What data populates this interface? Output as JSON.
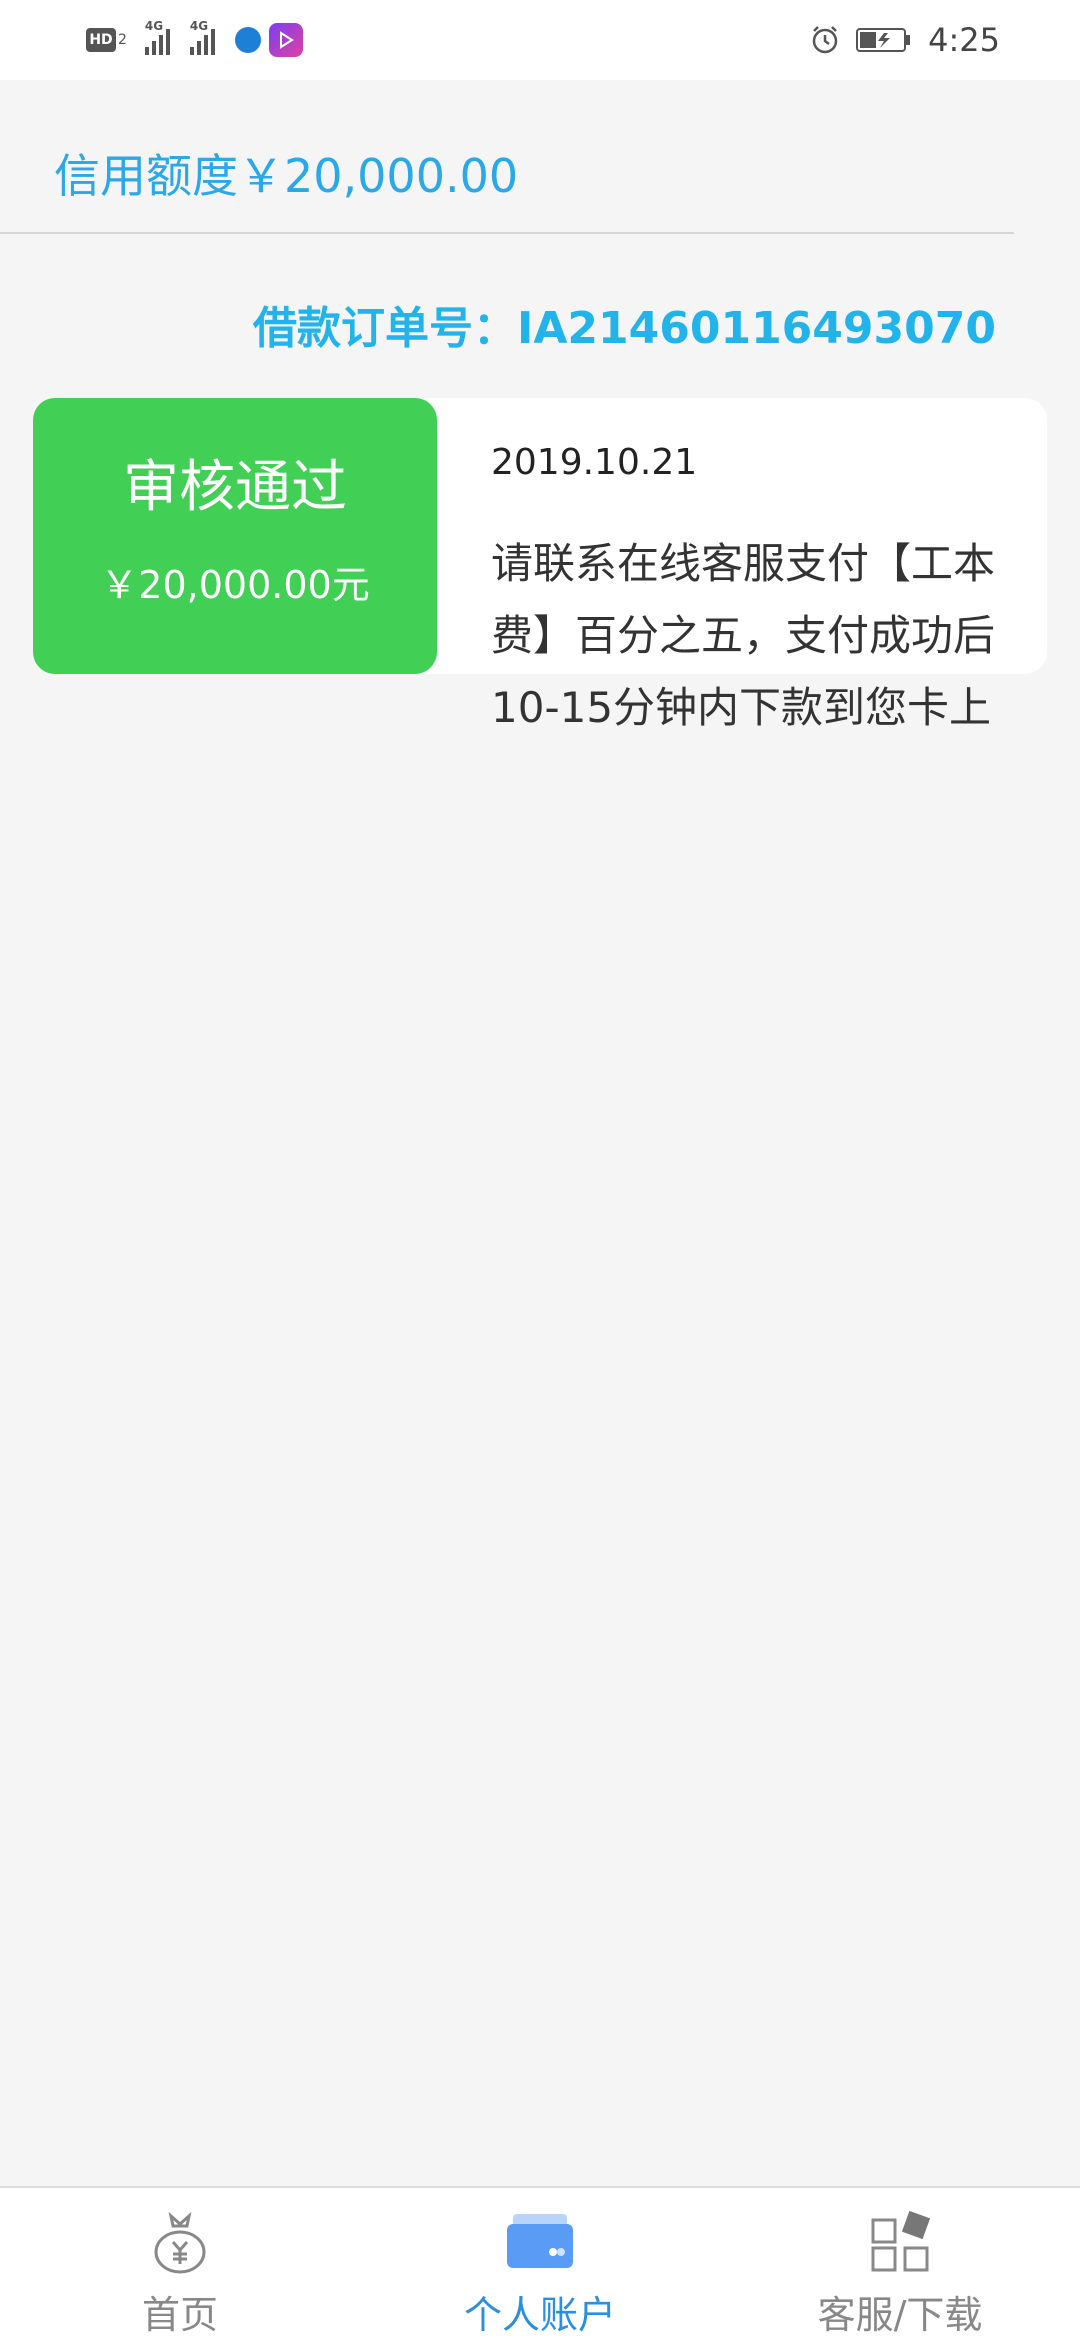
{
  "status_bar": {
    "hd": "HD",
    "hd_sub": "2",
    "net1": "4G",
    "net2": "4G",
    "time": "4:25"
  },
  "header": {
    "credit_text": "信用额度￥20,000.00",
    "order_text": "借款订单号：IA21460116493070"
  },
  "card": {
    "status": "审核通过",
    "amount": "￥20,000.00元",
    "date": "2019.10.21",
    "message": "请联系在线客服支付【工本费】百分之五，支付成功后10-15分钟内下款到您卡上"
  },
  "bottom_nav": {
    "items": [
      {
        "label": "首页",
        "icon": "money-bag-icon",
        "active": false
      },
      {
        "label": "个人账户",
        "icon": "wallet-icon",
        "active": true
      },
      {
        "label": "客服/下载",
        "icon": "apps-grid-icon",
        "active": false
      }
    ]
  },
  "colors": {
    "accent_blue": "#21b3ea",
    "status_green": "#41cf55",
    "nav_active": "#2b8fe0",
    "nav_inactive": "#888888"
  }
}
